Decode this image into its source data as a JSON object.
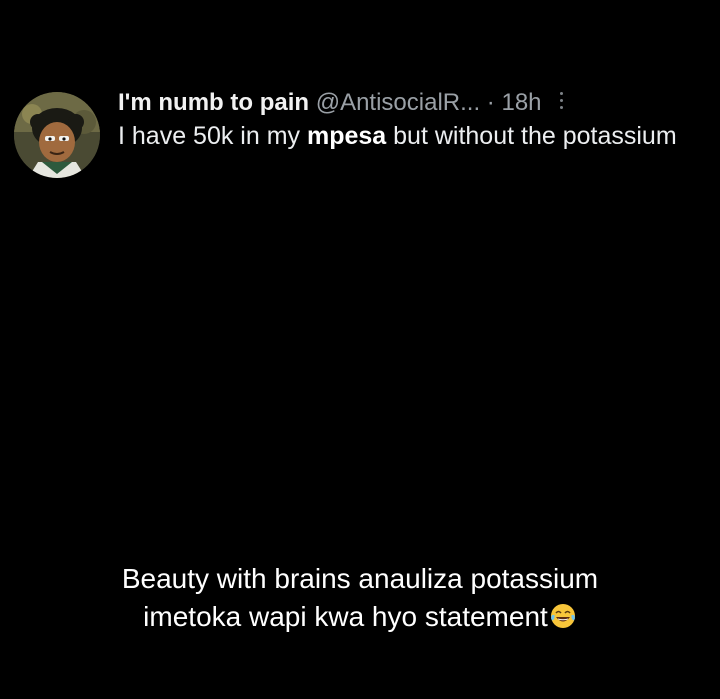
{
  "tweet": {
    "display_name": "I'm numb to pain",
    "handle": "@AntisocialR...",
    "separator": "·",
    "time": "18h",
    "text_before": "I have 50k in my ",
    "text_bold": "mpesa",
    "text_after": " but without the potassium",
    "avatar_icon": "cartoon-avatar-icon",
    "more_icon": "vertical-ellipsis-icon"
  },
  "caption": {
    "line1": "Beauty with brains anauliza potassium",
    "line2": "imetoka wapi kwa hyo statement",
    "emoji_icon": "tears-of-joy-emoji-icon"
  },
  "colors": {
    "background": "#000000",
    "primary_text": "#e7e9ea",
    "secondary_text": "#9aa0a6"
  }
}
